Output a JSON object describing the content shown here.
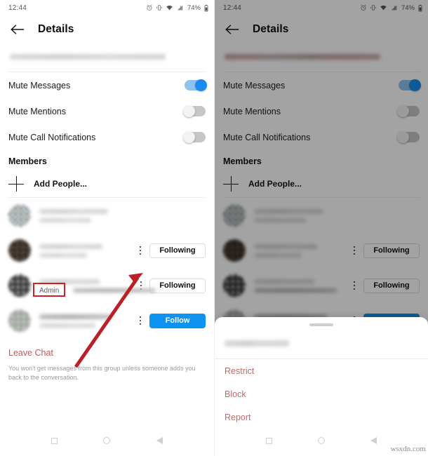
{
  "status_bar": {
    "time": "12:44",
    "battery_percent": "74%",
    "icons": [
      "alarm-icon",
      "vibrate-icon",
      "wifi-icon",
      "signal-icon",
      "battery-icon"
    ]
  },
  "app_bar": {
    "back_icon": "back-arrow-icon",
    "title": "Details"
  },
  "settings": {
    "rows": [
      {
        "label": "Mute Messages",
        "state": "on"
      },
      {
        "label": "Mute Mentions",
        "state": "off"
      },
      {
        "label": "Mute Call Notifications",
        "state": "off"
      }
    ]
  },
  "members": {
    "heading": "Members",
    "add_people_label": "Add People...",
    "rows": [
      {
        "avatar": "av1",
        "name_redacted": true,
        "badge": null,
        "action": null
      },
      {
        "avatar": "av2",
        "name_redacted": true,
        "badge": null,
        "action": "Following"
      },
      {
        "avatar": "av3",
        "name_redacted": true,
        "badge": "Admin",
        "action": "Following"
      },
      {
        "avatar": "av4",
        "name_redacted": true,
        "badge": null,
        "action": "Follow"
      }
    ]
  },
  "leave": {
    "label": "Leave Chat",
    "note": "You won't get messages from this group unless someone adds you back to the conversation."
  },
  "bottom_sheet": {
    "handle": "drag-handle",
    "username_redacted": true,
    "options": [
      "Restrict",
      "Block",
      "Report"
    ]
  },
  "nav_bar": {
    "items": [
      "recents-square-icon",
      "home-circle-icon",
      "back-triangle-icon"
    ]
  },
  "annotations": {
    "admin_highlight_color": "#cc2027",
    "arrow_color": "#bb2026",
    "arrow_target": "member-overflow-menu"
  },
  "watermark": "wsxdn.com",
  "colors": {
    "accent_blue": "#0f93f0",
    "toggle_on": "#1a8cf0",
    "destructive_red": "#bb5a5a",
    "annotation_red": "#cc2027"
  }
}
